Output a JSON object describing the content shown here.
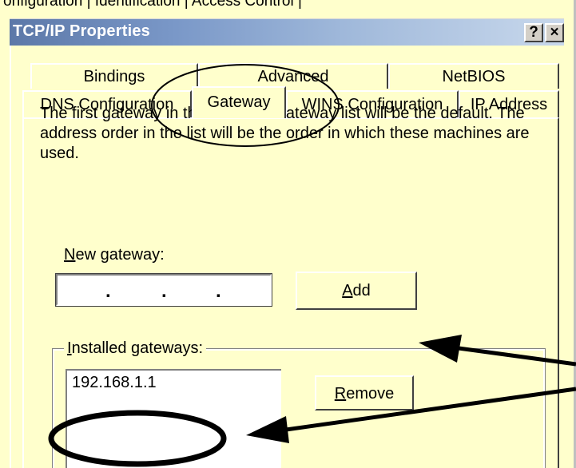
{
  "background": {
    "behind_tabs_text": "onfiguration | Identification | Access Control |"
  },
  "window": {
    "title": "TCP/IP Properties",
    "help_label": "?",
    "close_label": "×"
  },
  "tabs": {
    "row1": [
      "Bindings",
      "Advanced",
      "NetBIOS"
    ],
    "row2": [
      "DNS Configuration",
      "Gateway",
      "WINS Configuration",
      "IP Address"
    ],
    "active": "Gateway"
  },
  "gateway_panel": {
    "description": "The first gateway in the Installed Gateway list will be the default. The address order in the list will be the order in which these machines are used.",
    "new_gateway_label_first": "N",
    "new_gateway_label_rest": "ew gateway:",
    "new_gateway_value": ". . .",
    "add_button_first": "A",
    "add_button_rest": "dd",
    "installed_label_first": "I",
    "installed_label_rest": "nstalled gateways:",
    "installed_items": [
      "192.168.1.1"
    ],
    "remove_button_first": "R",
    "remove_button_rest": "emove"
  },
  "colors": {
    "dialog_bg": "#ffffcc",
    "titlebar_start": "#5c78a8",
    "titlebar_end": "#c8d8ec",
    "annotation": "#000000"
  }
}
